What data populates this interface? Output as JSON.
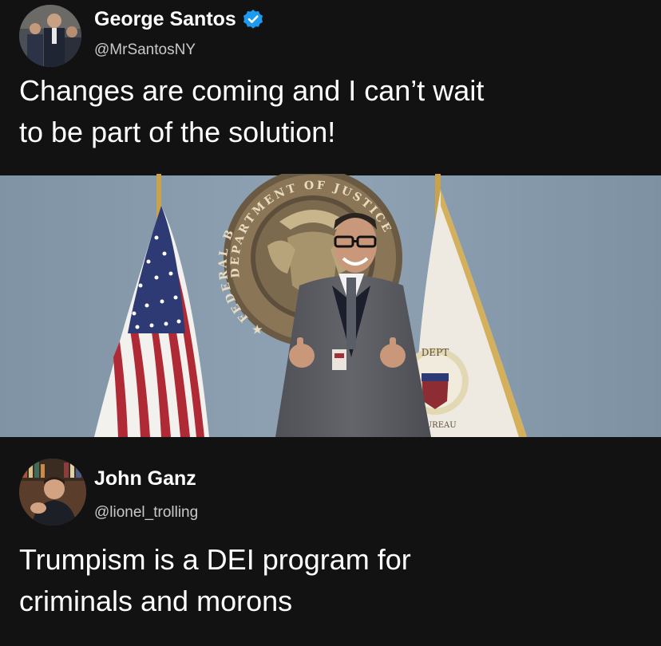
{
  "tweets": [
    {
      "author": {
        "display_name": "George Santos",
        "handle": "@MrSantosNY",
        "verified": true
      },
      "text_lines": [
        "Changes are coming and I can’t wait",
        "to be part of the solution!"
      ],
      "media": {
        "seal_text_top": "DEPARTMENT OF JUSTICE",
        "seal_text_left": "★ FEDERAL B",
        "flag_seal_text": "DEPT",
        "flag_seal_bottom": "AL BUREAU"
      }
    },
    {
      "author": {
        "display_name": "John Ganz",
        "handle": "@lionel_trolling",
        "verified": false
      },
      "text_lines": [
        "Trumpism is a DEI program for",
        "criminals and morons"
      ]
    }
  ],
  "colors": {
    "background": "#121212",
    "text": "#ffffff",
    "handle": "#c9c9c9",
    "verified": "#1d9bf0"
  },
  "icons": {
    "verified": "verified-badge-icon"
  }
}
